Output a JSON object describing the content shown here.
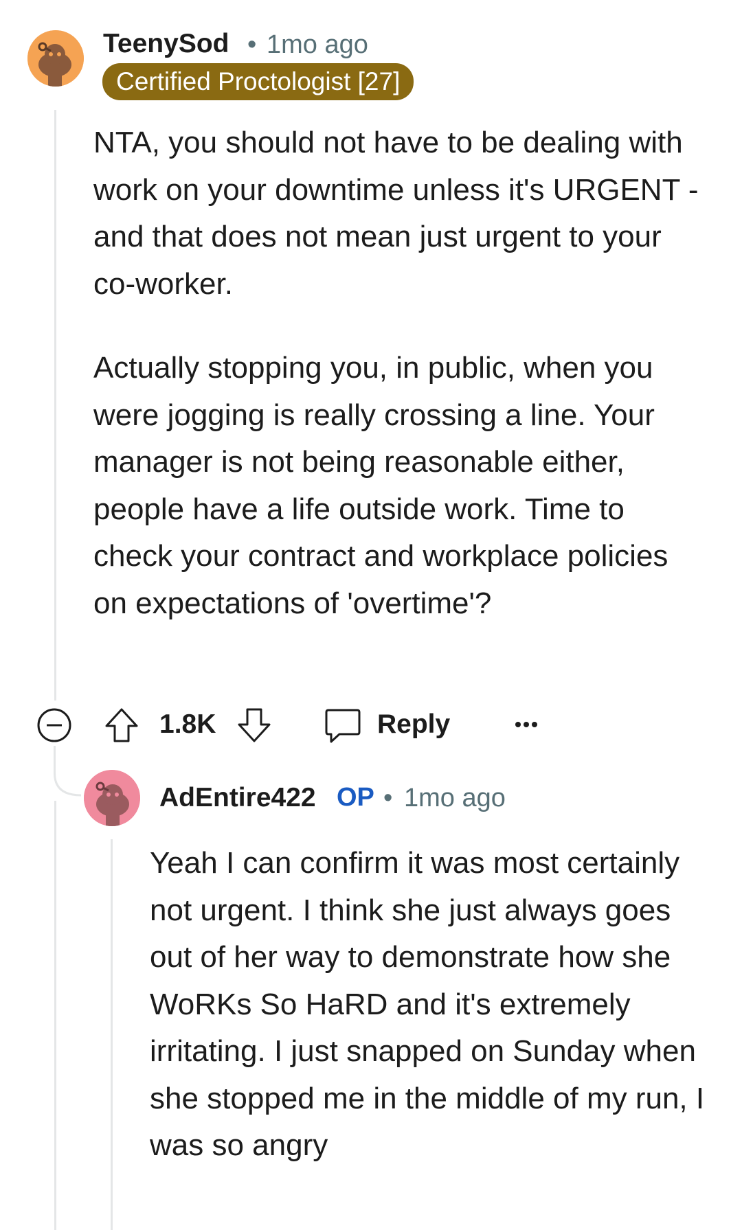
{
  "comment": {
    "username": "TeenySod",
    "separator": "•",
    "time": "1mo ago",
    "flair": "Certified Proctologist [27]",
    "paragraphs": [
      "NTA, you should not have to be dealing with work on your downtime unless it's URGENT - and that does not mean just urgent to your co-worker.",
      "Actually stopping you, in public, when you were jogging is really crossing a line. Your manager is not being reasonable either, people have a life outside work. Time to check your contract and workplace policies on expectations of 'overtime'?"
    ],
    "score": "1.8K",
    "reply_label": "Reply",
    "icons": [
      "collapse-icon",
      "upvote-icon",
      "downvote-icon",
      "comment-bubble-icon",
      "more-options-icon"
    ]
  },
  "reply": {
    "username": "AdEntire422",
    "op_badge": "OP",
    "separator": "•",
    "time": "1mo ago",
    "paragraphs": [
      "Yeah I can confirm it was most certainly not urgent. I think she just always goes out of her way to demonstrate how she WoRKs So HaRD and it's extremely irritating. I just snapped on Sunday when she stopped me in the middle of my run, I was so angry"
    ]
  },
  "colors": {
    "flair_bg": "#8a6a12",
    "op_blue": "#1a5bc2",
    "avatar1_bg": "#f5a353",
    "avatar2_bg": "#f08a9d"
  }
}
